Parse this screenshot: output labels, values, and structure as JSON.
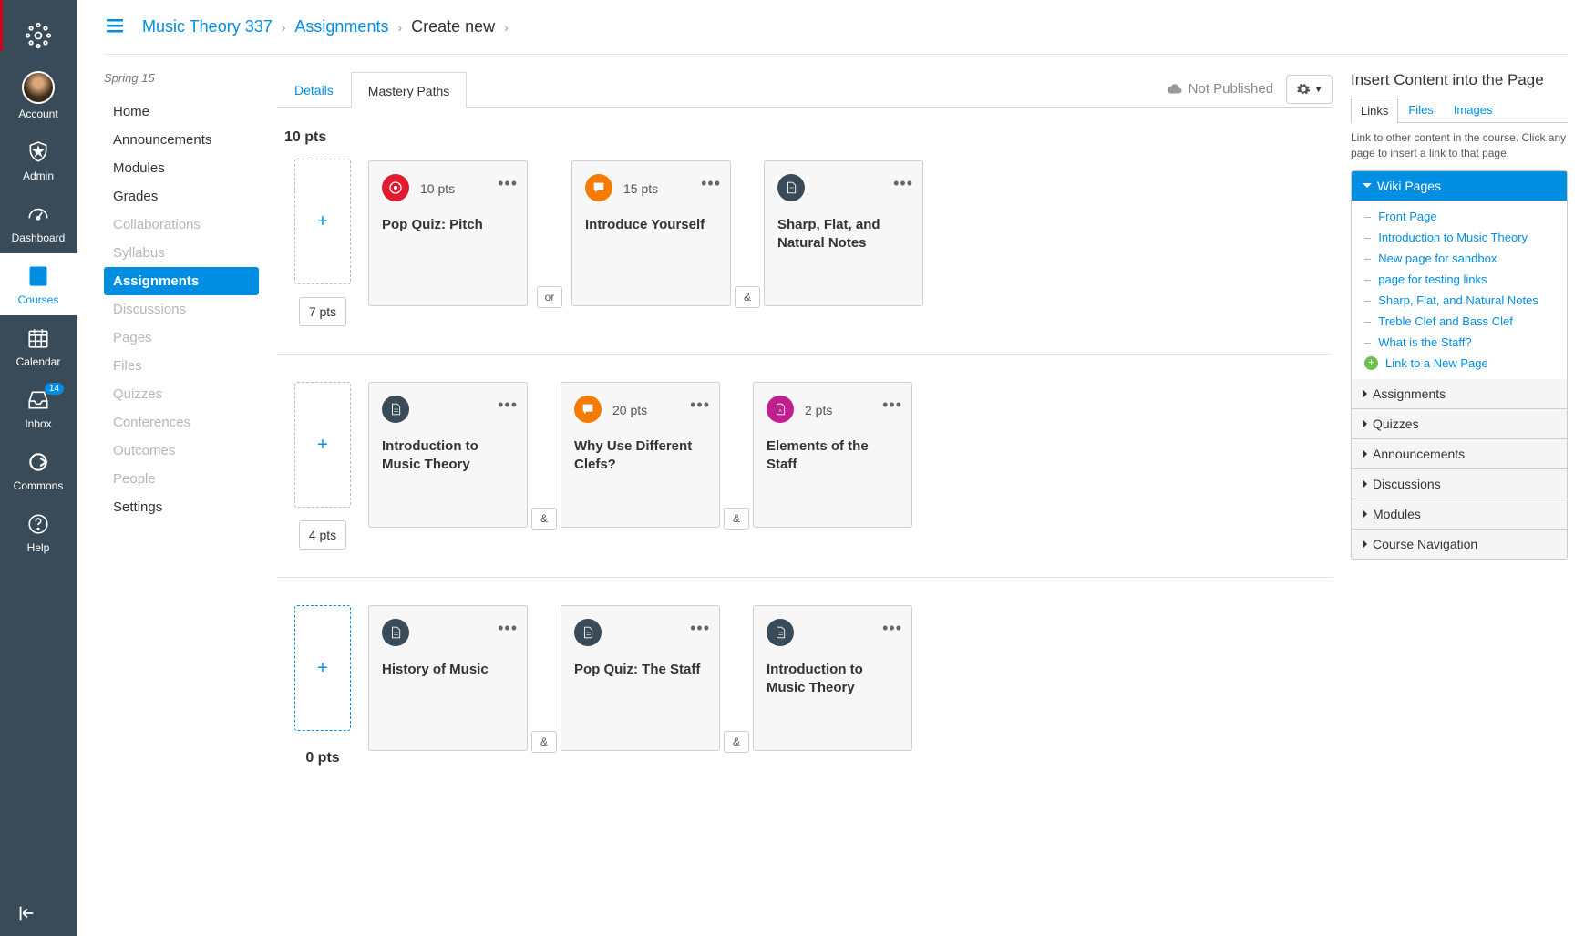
{
  "global_nav": {
    "items": [
      {
        "label": "Account"
      },
      {
        "label": "Admin"
      },
      {
        "label": "Dashboard"
      },
      {
        "label": "Courses",
        "active": true
      },
      {
        "label": "Calendar"
      },
      {
        "label": "Inbox",
        "badge": "14"
      },
      {
        "label": "Commons"
      },
      {
        "label": "Help"
      }
    ]
  },
  "breadcrumb": {
    "course": "Music Theory 337",
    "section": "Assignments",
    "current": "Create new"
  },
  "term": "Spring 15",
  "course_nav": [
    {
      "label": "Home"
    },
    {
      "label": "Announcements"
    },
    {
      "label": "Modules"
    },
    {
      "label": "Grades"
    },
    {
      "label": "Collaborations",
      "disabled": true
    },
    {
      "label": "Syllabus",
      "disabled": true
    },
    {
      "label": "Assignments",
      "active": true
    },
    {
      "label": "Discussions",
      "disabled": true
    },
    {
      "label": "Pages",
      "disabled": true
    },
    {
      "label": "Files",
      "disabled": true
    },
    {
      "label": "Quizzes",
      "disabled": true
    },
    {
      "label": "Conferences",
      "disabled": true
    },
    {
      "label": "Outcomes",
      "disabled": true
    },
    {
      "label": "People",
      "disabled": true
    },
    {
      "label": "Settings"
    }
  ],
  "tabs": {
    "details": "Details",
    "mastery": "Mastery Paths"
  },
  "status": "Not Published",
  "rows": [
    {
      "top": "10 pts",
      "bot": "7 pts",
      "bot_plain": false,
      "selected": false,
      "groups": [
        {
          "conn_after": "or",
          "cards": [
            {
              "icon": "quiz",
              "color": "ic-red",
              "pts": "10 pts",
              "title": "Pop Quiz: Pitch"
            }
          ]
        },
        {
          "conn_after": null,
          "cards": [
            {
              "icon": "discussion",
              "color": "ic-orange",
              "pts": "15 pts",
              "title": "Introduce Yourself"
            },
            {
              "icon": "page",
              "color": "ic-dark",
              "pts": "",
              "title": "Sharp, Flat, and Natural Notes"
            }
          ]
        }
      ]
    },
    {
      "top": "",
      "bot": "4 pts",
      "bot_plain": false,
      "selected": false,
      "groups": [
        {
          "conn_after": null,
          "cards": [
            {
              "icon": "page",
              "color": "ic-dark",
              "pts": "",
              "title": "Introduction to Music Theory"
            },
            {
              "icon": "discussion",
              "color": "ic-orange",
              "pts": "20 pts",
              "title": "Why Use Different Clefs?"
            },
            {
              "icon": "assignment",
              "color": "ic-pink",
              "pts": "2 pts",
              "title": "Elements of the Staff"
            }
          ]
        }
      ]
    },
    {
      "top": "",
      "bot": "0 pts",
      "bot_plain": true,
      "selected": true,
      "groups": [
        {
          "conn_after": null,
          "cards": [
            {
              "icon": "page",
              "color": "ic-dark",
              "pts": "",
              "title": "History of Music"
            },
            {
              "icon": "page",
              "color": "ic-dark",
              "pts": "",
              "title": "Pop Quiz: The Staff"
            },
            {
              "icon": "page",
              "color": "ic-dark",
              "pts": "",
              "title": "Introduction to Music Theory"
            }
          ]
        }
      ]
    }
  ],
  "sidebar": {
    "heading": "Insert Content into the Page",
    "tabs": [
      "Links",
      "Files",
      "Images"
    ],
    "help": "Link to other content in the course. Click any page to insert a link to that page.",
    "open_section": "Wiki Pages",
    "wiki_pages": [
      "Front Page",
      "Introduction to Music Theory",
      "New page for sandbox",
      "page for testing links",
      "Sharp, Flat, and Natural Notes",
      "Treble Clef and Bass Clef",
      "What is the Staff?"
    ],
    "new_page": "Link to a New Page",
    "sections": [
      "Assignments",
      "Quizzes",
      "Announcements",
      "Discussions",
      "Modules",
      "Course Navigation"
    ]
  }
}
